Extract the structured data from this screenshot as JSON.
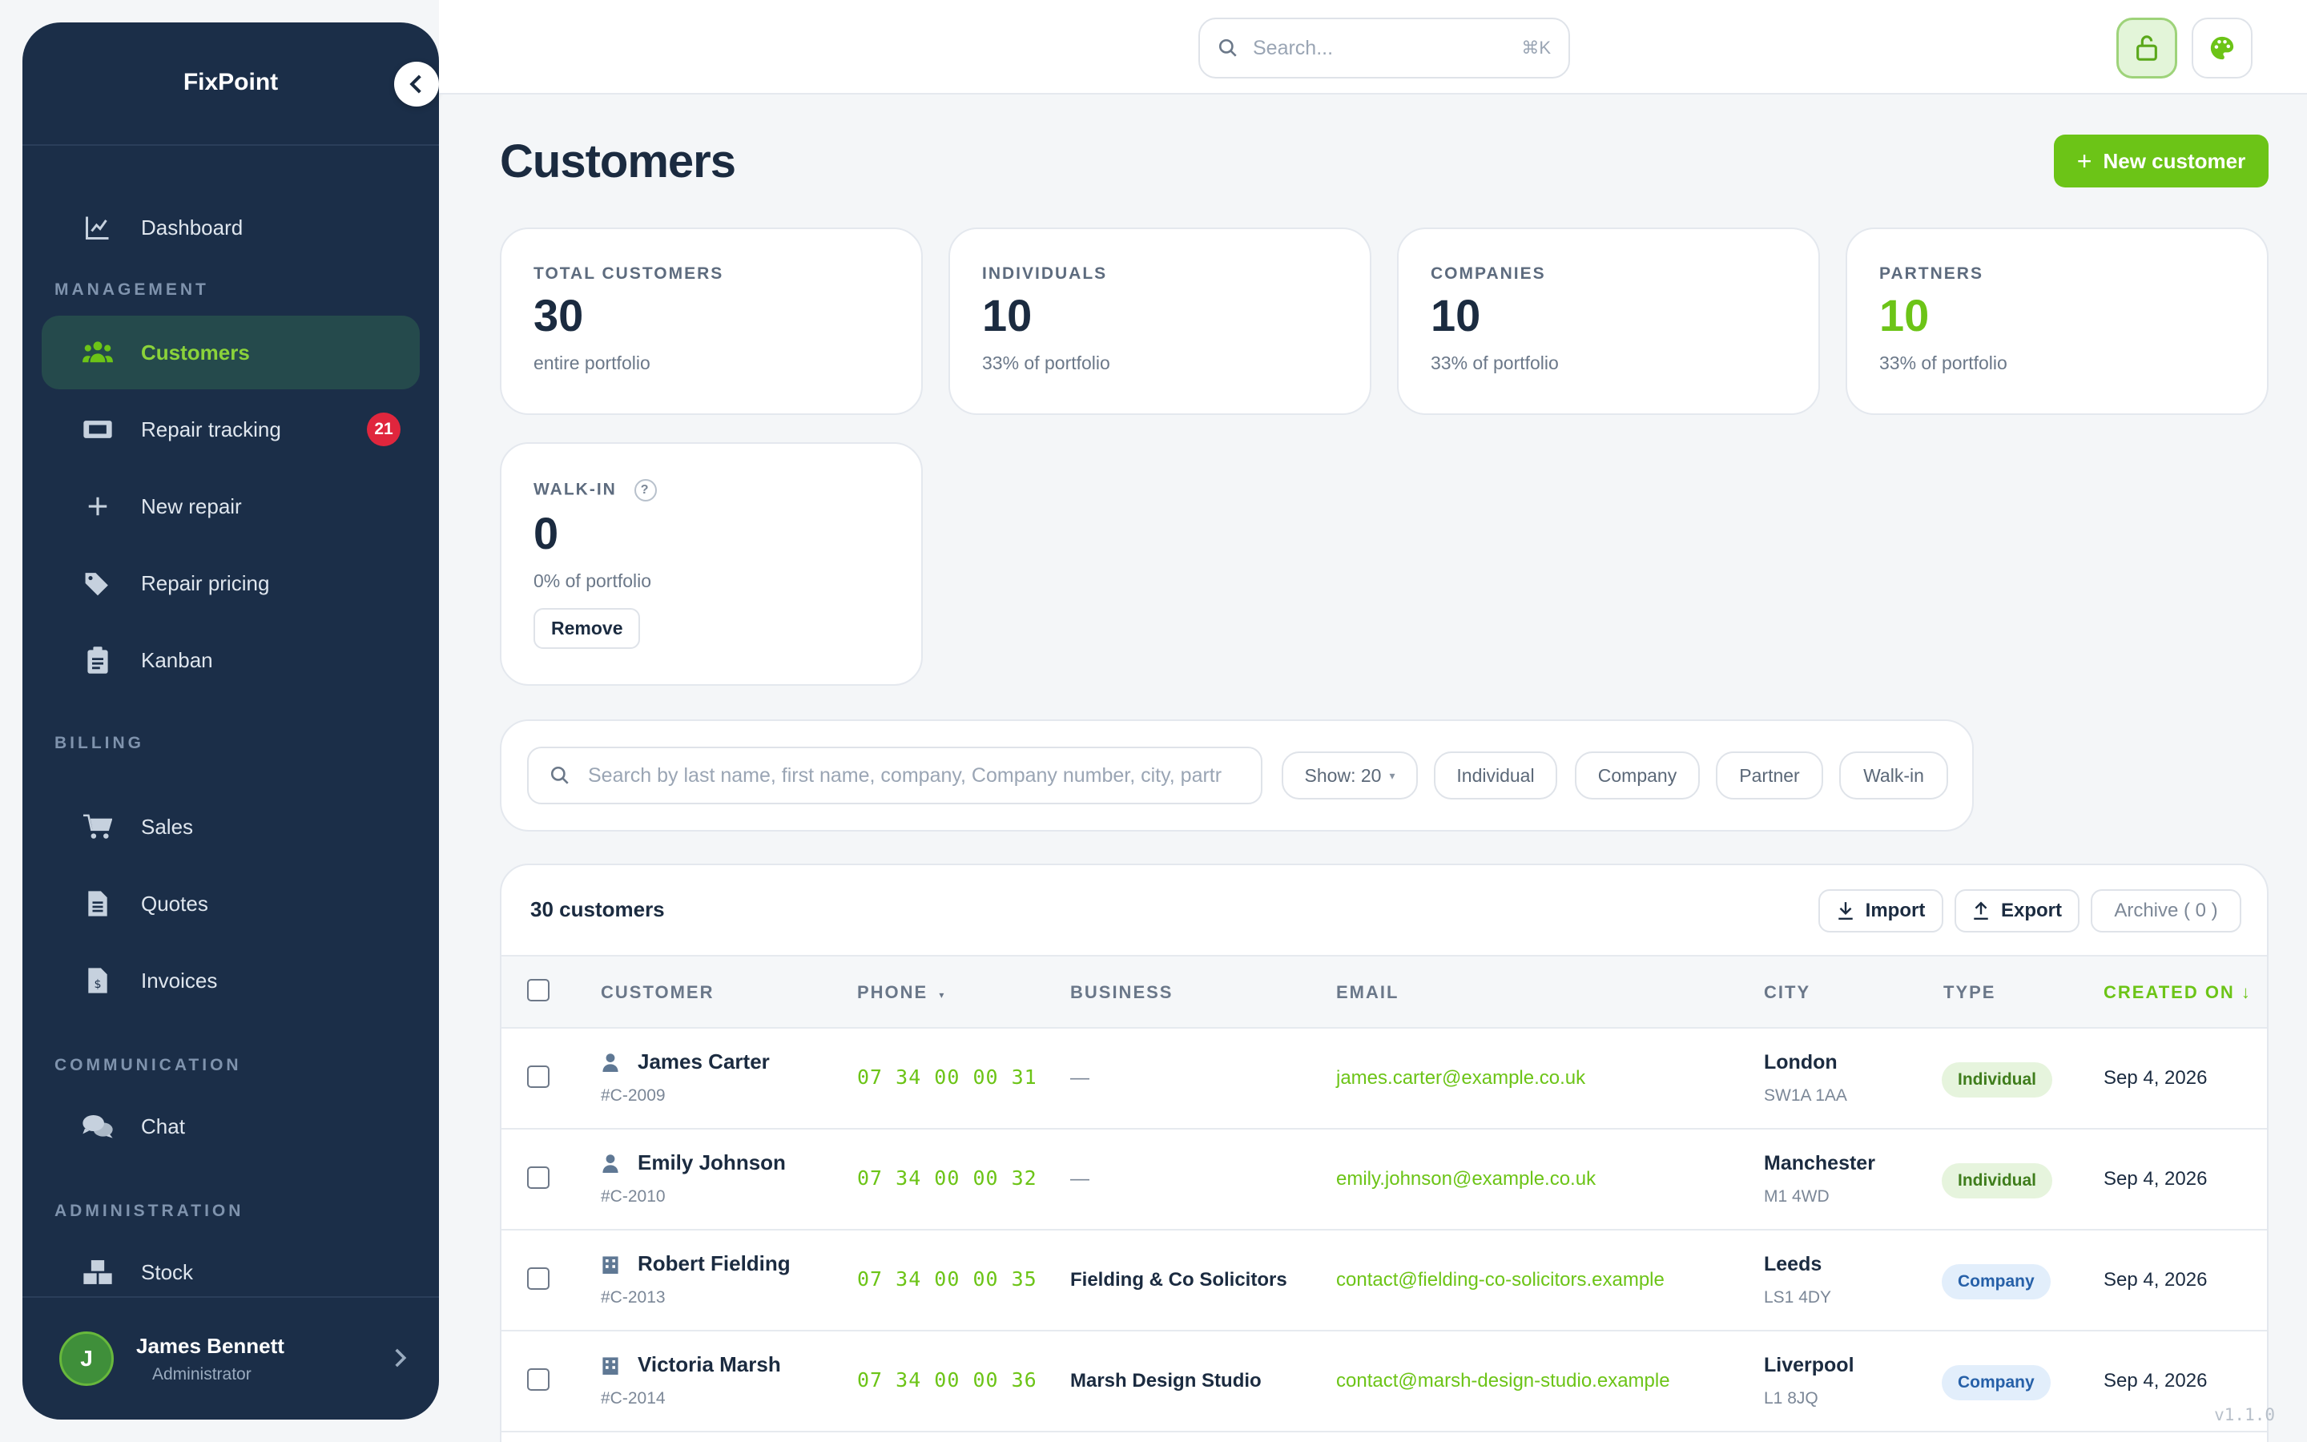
{
  "brand": "FixPoint",
  "sidebar": {
    "sections": {
      "management": "MANAGEMENT",
      "billing": "BILLING",
      "communication": "COMMUNICATION",
      "administration": "ADMINISTRATION"
    },
    "items": {
      "dashboard": "Dashboard",
      "customers": "Customers",
      "repair_tracking": "Repair tracking",
      "repair_tracking_badge": "21",
      "new_repair": "New repair",
      "repair_pricing": "Repair pricing",
      "kanban": "Kanban",
      "sales": "Sales",
      "quotes": "Quotes",
      "invoices": "Invoices",
      "chat": "Chat",
      "stock": "Stock"
    },
    "user": {
      "initial": "J",
      "name": "James Bennett",
      "role": "Administrator"
    }
  },
  "topbar": {
    "search_placeholder": "Search...",
    "search_shortcut": "⌘K"
  },
  "page": {
    "title": "Customers",
    "new_customer_label": "New customer"
  },
  "stats": {
    "total": {
      "label": "TOTAL CUSTOMERS",
      "value": "30",
      "sub": "entire portfolio"
    },
    "individuals": {
      "label": "INDIVIDUALS",
      "value": "10",
      "sub": "33% of portfolio"
    },
    "companies": {
      "label": "COMPANIES",
      "value": "10",
      "sub": "33% of portfolio"
    },
    "partners": {
      "label": "PARTNERS",
      "value": "10",
      "sub": "33% of portfolio"
    },
    "walkin": {
      "label": "WALK-IN",
      "help": "?",
      "value": "0",
      "sub": "0% of portfolio",
      "remove_label": "Remove"
    }
  },
  "filters": {
    "search_placeholder": "Search by last name, first name, company, Company number, city, partr",
    "show": "Show: 20",
    "show_caret": "▾",
    "chips": [
      "Individual",
      "Company",
      "Partner",
      "Walk-in"
    ]
  },
  "table": {
    "count": "30 customers",
    "import_label": "Import",
    "export_label": "Export",
    "archive_label": "Archive ( 0 )",
    "columns": {
      "customer": "CUSTOMER",
      "phone": "PHONE",
      "phone_caret": "▾",
      "business": "BUSINESS",
      "email": "EMAIL",
      "city": "CITY",
      "type": "TYPE",
      "created": "CREATED ON ↓"
    },
    "rows": [
      {
        "name": "James Carter",
        "id": "#C-2009",
        "phone": "07 34 00 00 31",
        "business": "—",
        "email": "james.carter@example.co.uk",
        "city": "London",
        "postcode": "SW1A 1AA",
        "type": "Individual",
        "created": "Sep 4, 2026"
      },
      {
        "name": "Emily Johnson",
        "id": "#C-2010",
        "phone": "07 34 00 00 32",
        "business": "—",
        "email": "emily.johnson@example.co.uk",
        "city": "Manchester",
        "postcode": "M1 4WD",
        "type": "Individual",
        "created": "Sep 4, 2026"
      },
      {
        "name": "Robert Fielding",
        "id": "#C-2013",
        "phone": "07 34 00 00 35",
        "business": "Fielding & Co Solicitors",
        "email": "contact@fielding-co-solicitors.example",
        "city": "Leeds",
        "postcode": "LS1 4DY",
        "type": "Company",
        "created": "Sep 4, 2026"
      },
      {
        "name": "Victoria Marsh",
        "id": "#C-2014",
        "phone": "07 34 00 00 36",
        "business": "Marsh Design Studio",
        "email": "contact@marsh-design-studio.example",
        "city": "Liverpool",
        "postcode": "L1 8JQ",
        "type": "Company",
        "created": "Sep 4, 2026"
      }
    ]
  },
  "version": "v1.1.0",
  "colors": {
    "accent": "#6cc417",
    "sidebar": "#1b2e48",
    "danger": "#e0263d"
  }
}
